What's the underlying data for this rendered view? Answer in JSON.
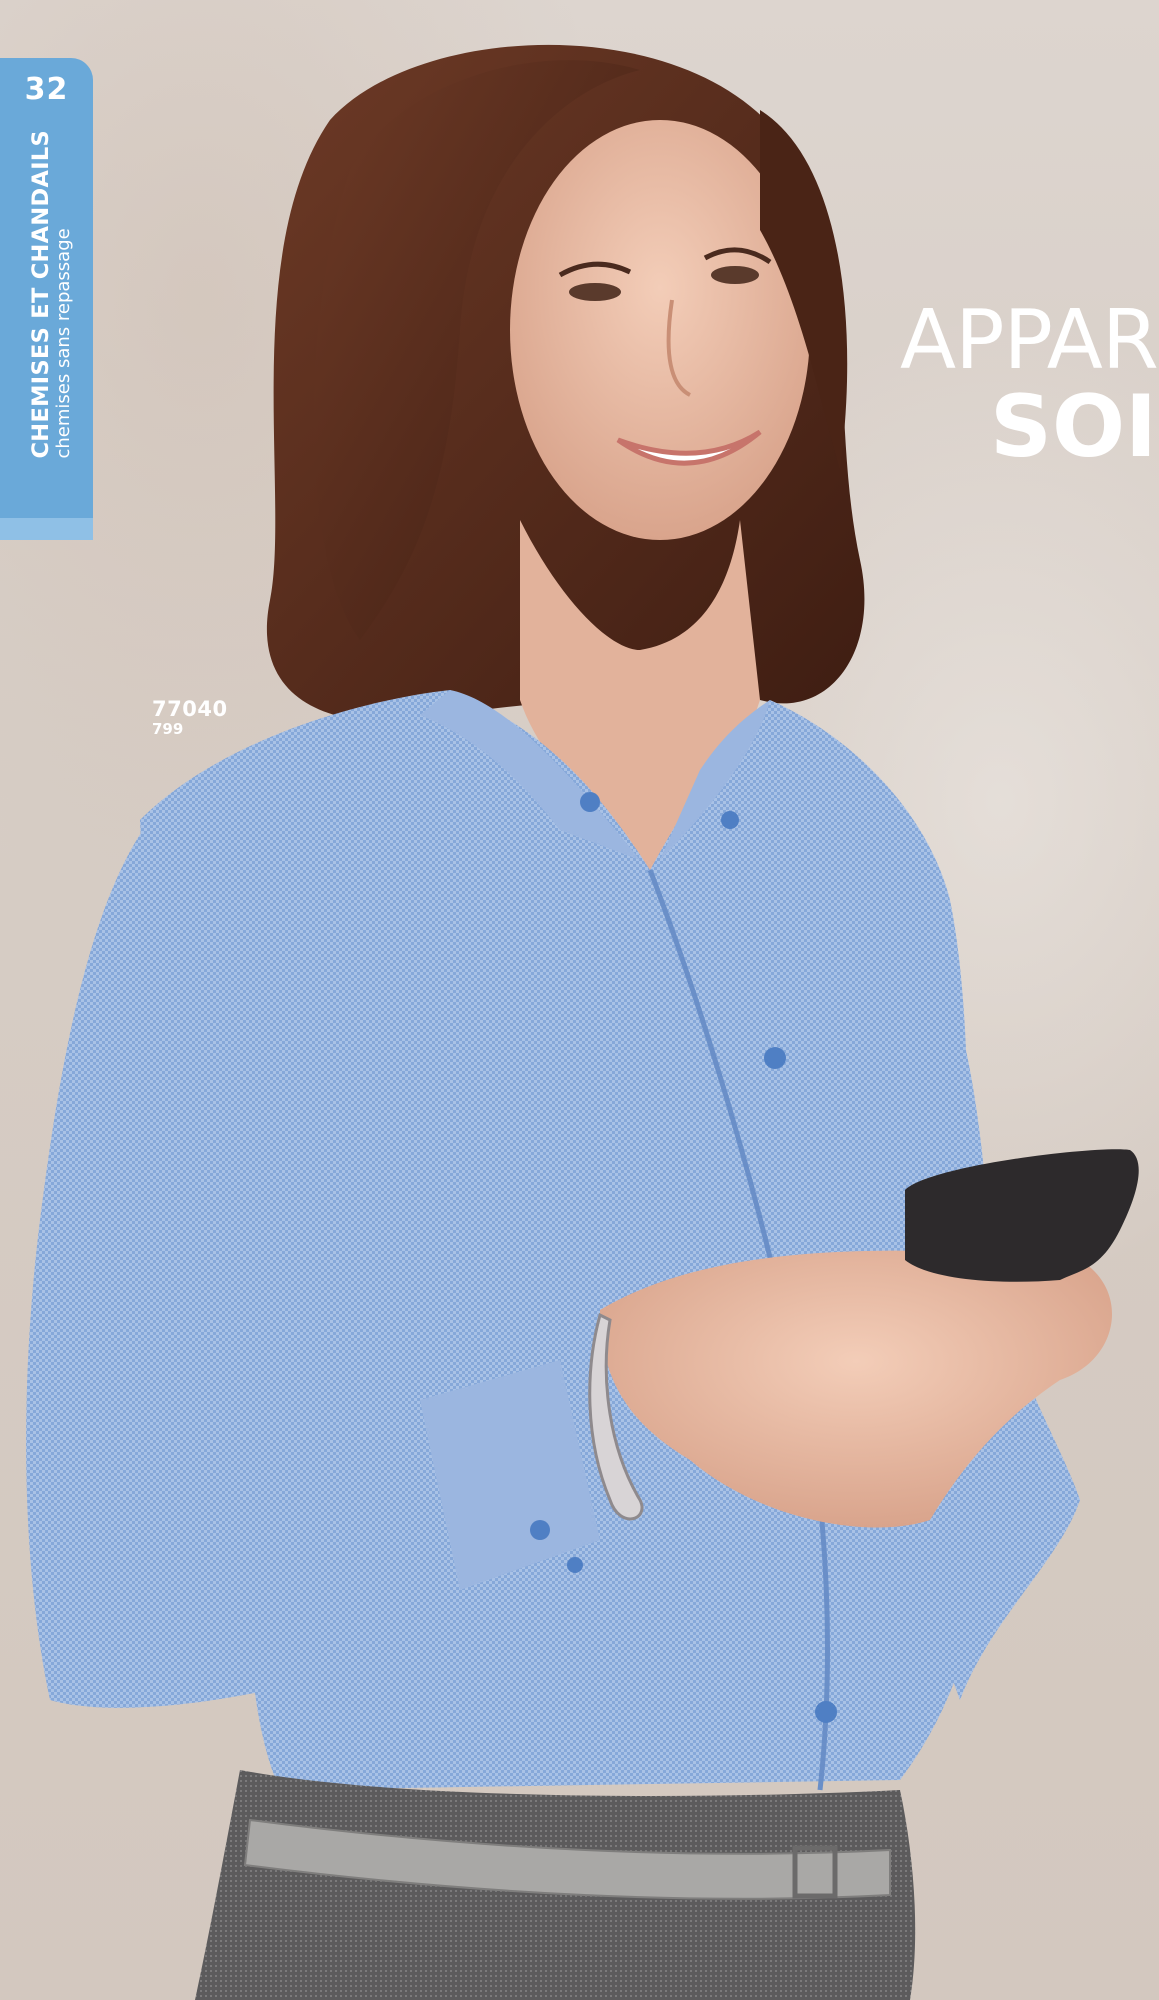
{
  "side_tab": {
    "page_number": "32",
    "title": "CHEMISES ET CHANDAILS",
    "subtitle": "chemises sans repassage"
  },
  "headline": {
    "line1": "APPAR",
    "line2": "SOI"
  },
  "product": {
    "style_number": "77040",
    "color_code": "799"
  },
  "colors": {
    "tab_blue": "#6aa9d9",
    "shirt_blue": "#7ea3d6",
    "text_white": "#ffffff"
  }
}
